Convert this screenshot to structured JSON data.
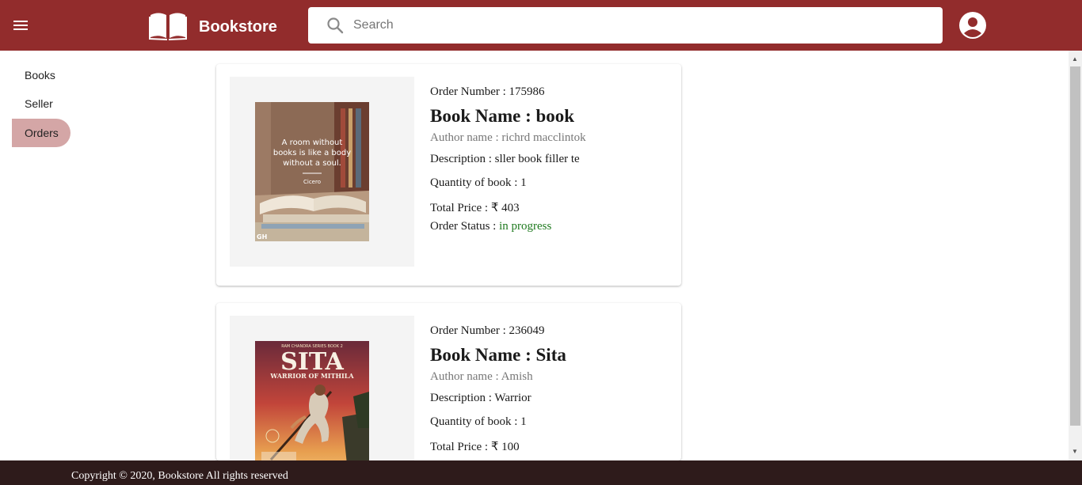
{
  "header": {
    "brand": "Bookstore",
    "search_placeholder": "Search",
    "search_value": ""
  },
  "sidebar": {
    "items": [
      {
        "label": "Books"
      },
      {
        "label": "Seller"
      },
      {
        "label": "Orders",
        "active": true
      }
    ]
  },
  "orders": [
    {
      "order_number_label": "Order Number : 175986",
      "book_name_label": "Book Name : book",
      "author_label": "Author name : richrd macclintok",
      "description_label": "Description : sller book filler te",
      "quantity_label": "Quantity of book : 1",
      "total_price_label": "Total Price : ₹ 403",
      "status_prefix": "Order Status :",
      "status": "in progress",
      "cover": {
        "quote_line1": "A room without",
        "quote_line2": "books is like a body",
        "quote_line3": "without a soul.",
        "attribution": "Cicero",
        "corner_mark": "GH"
      }
    },
    {
      "order_number_label": "Order Number : 236049",
      "book_name_label": "Book Name : Sita",
      "author_label": "Author name : Amish",
      "description_label": "Description : Warrior",
      "quantity_label": "Quantity of book : 1",
      "total_price_label": "Total Price : ₹ 100",
      "cover": {
        "title": "SITA",
        "subtitle": "WARRIOR OF MITHILA",
        "series": "RAM CHANDRA SERIES BOOK 2"
      }
    }
  ],
  "footer": {
    "copyright": "Copyright © 2020, Bookstore All rights reserved"
  },
  "colors": {
    "header_bg": "#922c2c",
    "footer_bg": "#2e1b1b",
    "active_nav_bg": "#d4a6a6",
    "status_green": "#1f7a1f"
  }
}
